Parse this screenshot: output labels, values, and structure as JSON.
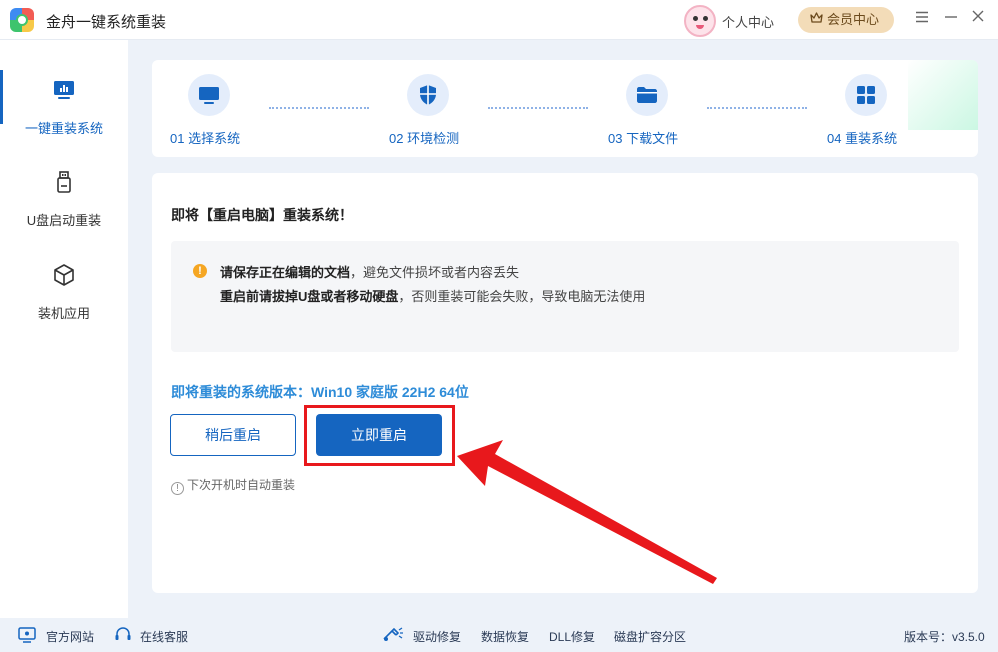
{
  "app": {
    "title": "金舟一键系统重装"
  },
  "header": {
    "personal_center": "个人中心",
    "vip_center": "会员中心"
  },
  "sidebar": {
    "items": [
      {
        "label": "一键重装系统",
        "active": true,
        "icon": "monitor-chart-icon"
      },
      {
        "label": "U盘启动重装",
        "active": false,
        "icon": "usb-drive-icon"
      },
      {
        "label": "装机应用",
        "active": false,
        "icon": "cube-icon"
      }
    ]
  },
  "steps": [
    {
      "label": "01 选择系统",
      "icon": "monitor-icon"
    },
    {
      "label": "02 环境检测",
      "icon": "shield-icon"
    },
    {
      "label": "03 下载文件",
      "icon": "folder-icon"
    },
    {
      "label": "04 重装系统",
      "icon": "windows-icon"
    }
  ],
  "main": {
    "headline": "即将【重启电脑】重装系统！",
    "notices": [
      {
        "bold": "请保存正在编辑的文档",
        "rest": "，避免文件损坏或者内容丢失"
      },
      {
        "bold": "重启前请拔掉U盘或者移动硬盘",
        "rest": "，否则重装可能会失败，导致电脑无法使用"
      }
    ],
    "version_line": "即将重装的系统版本：Win10 家庭版 22H2 64位",
    "later_button": "稍后重启",
    "now_button": "立即重启",
    "auto_note": "下次开机时自动重装"
  },
  "footer": {
    "official_site": "官方网站",
    "online_support": "在线客服",
    "driver_repair": "驱动修复",
    "data_recovery": "数据恢复",
    "dll_repair": "DLL修复",
    "disk_partition": "磁盘扩容分区",
    "version": "版本号：v3.5.0"
  },
  "colors": {
    "accent": "#1565c0",
    "highlight": "#e8181c",
    "version_text": "#2e8cd8",
    "warning": "#f5a623"
  }
}
